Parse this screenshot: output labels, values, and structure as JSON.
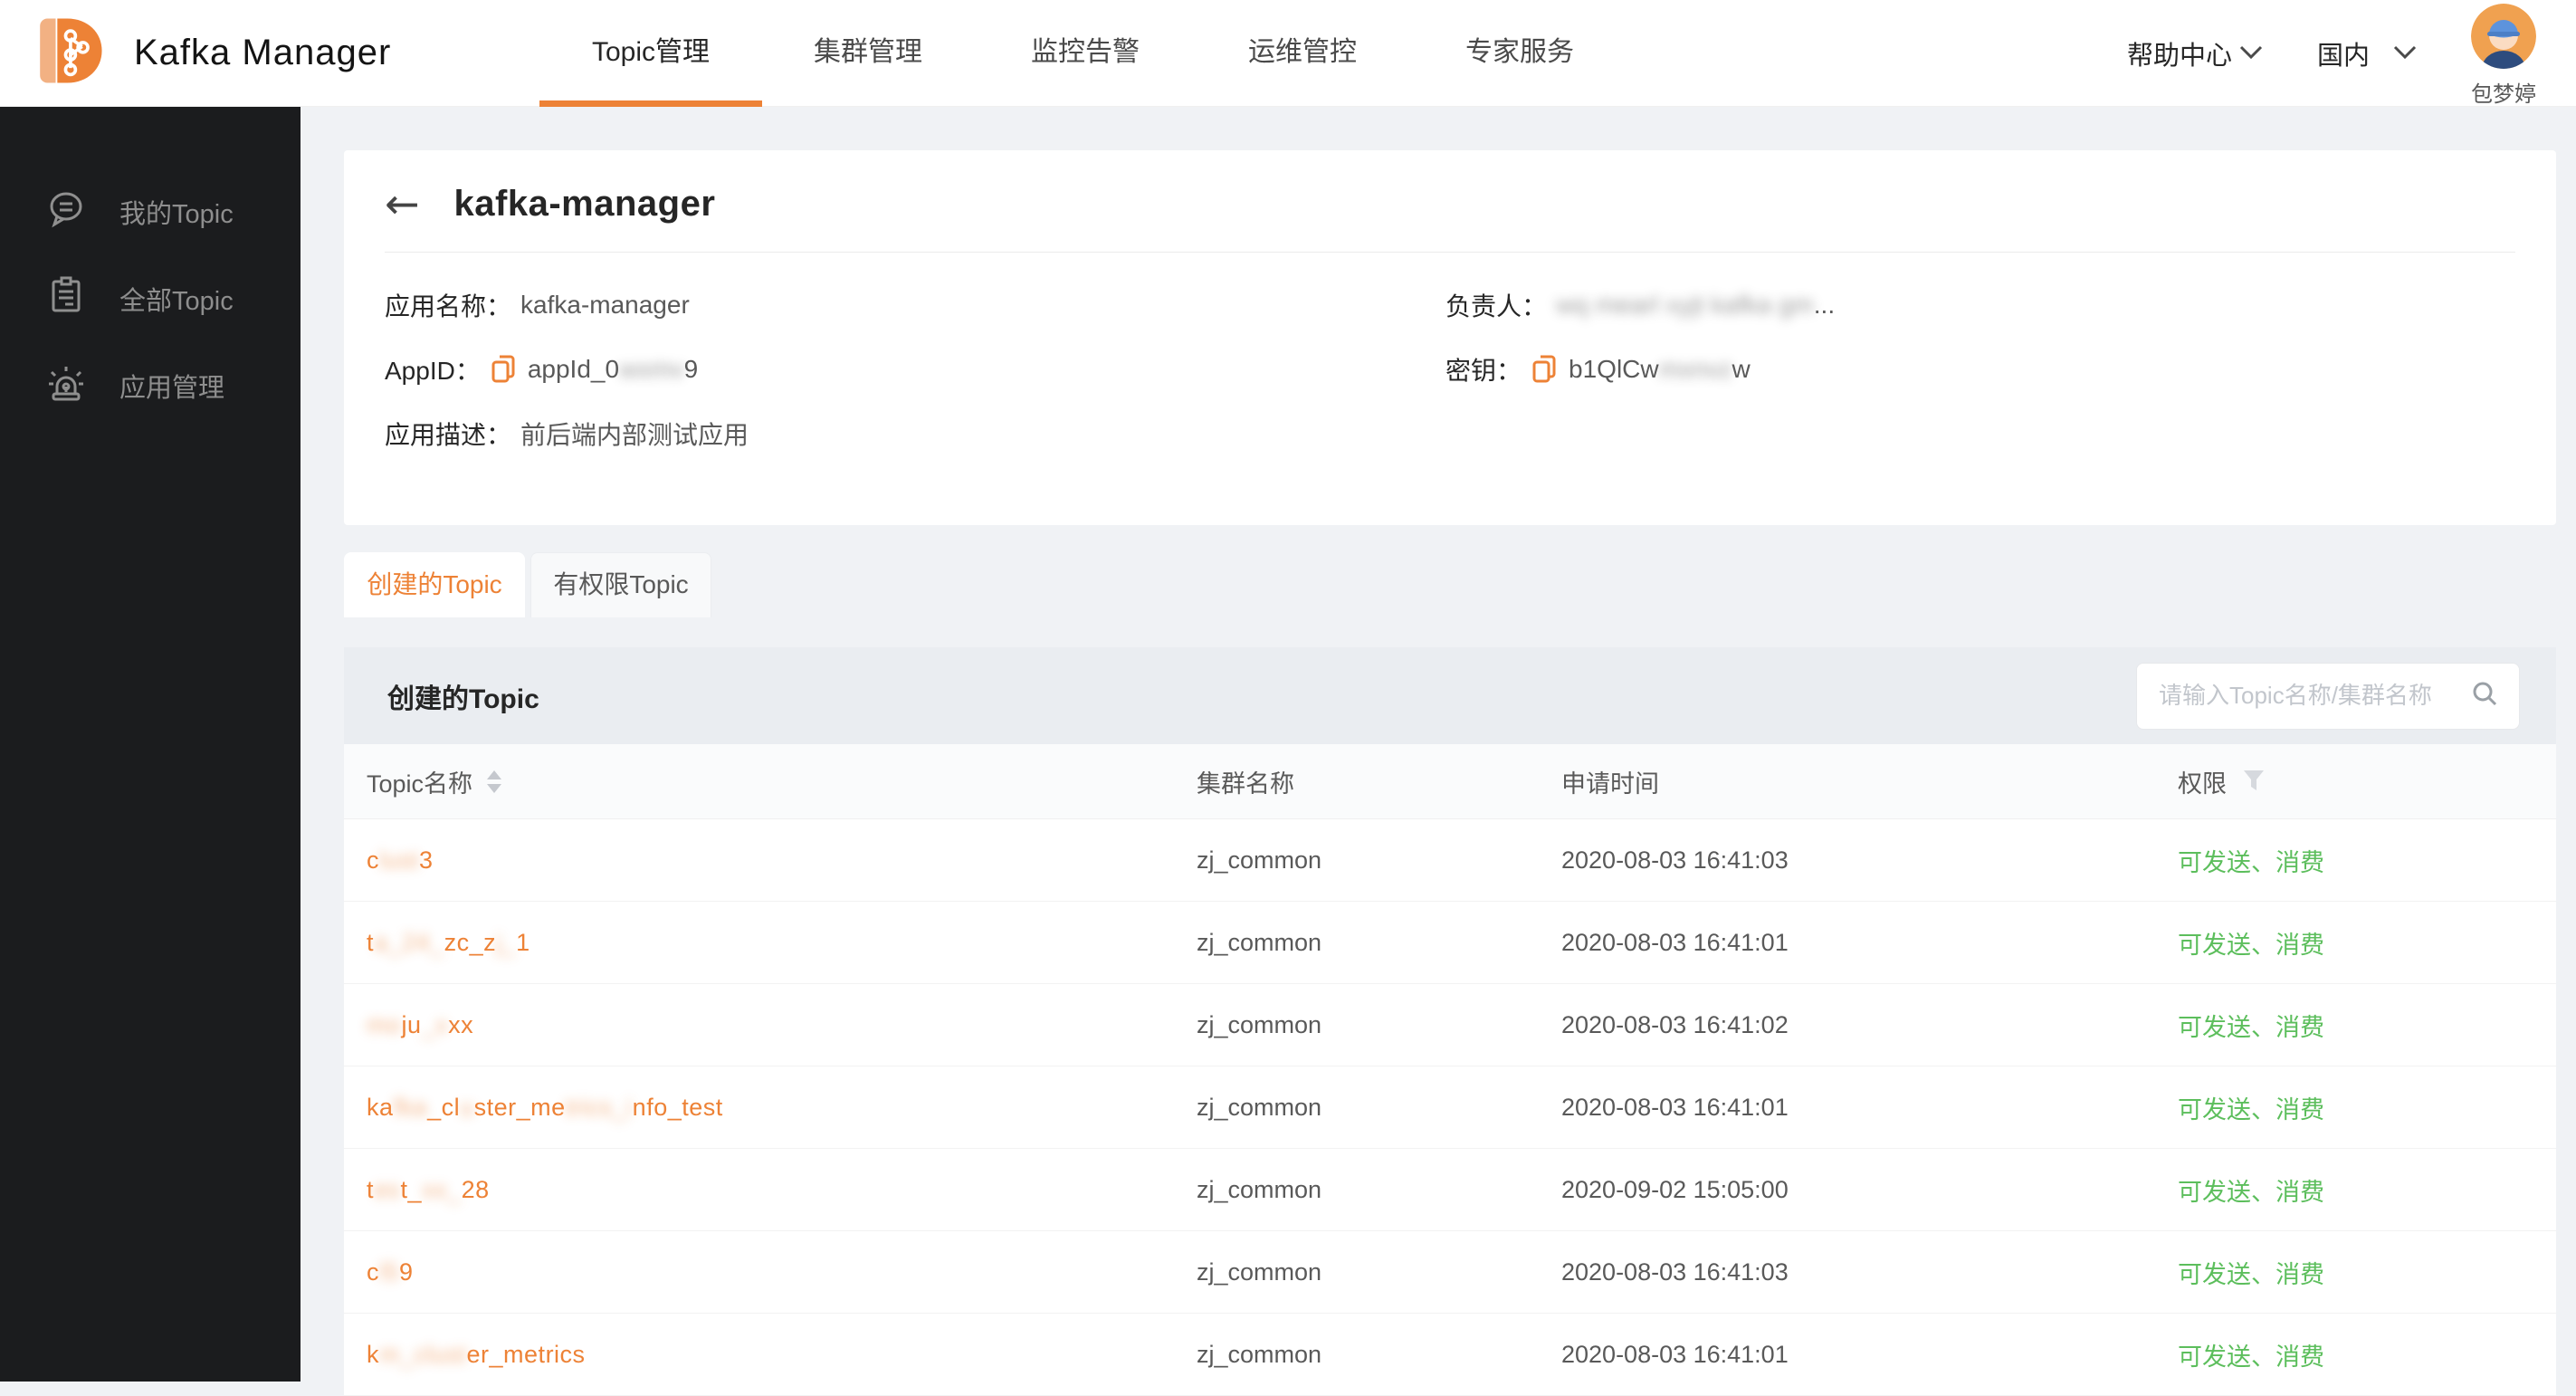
{
  "header": {
    "app_title": "Kafka Manager",
    "nav": [
      {
        "label": "Topic管理",
        "active": true
      },
      {
        "label": "集群管理",
        "active": false
      },
      {
        "label": "监控告警",
        "active": false
      },
      {
        "label": "运维管控",
        "active": false
      },
      {
        "label": "专家服务",
        "active": false
      }
    ],
    "help_label": "帮助中心",
    "region_label": "国内",
    "user_name": "包梦婷"
  },
  "sidebar": {
    "items": [
      {
        "label": "我的Topic",
        "icon": "chat-icon"
      },
      {
        "label": "全部Topic",
        "icon": "clipboard-icon"
      },
      {
        "label": "应用管理",
        "icon": "siren-icon"
      }
    ]
  },
  "app_card": {
    "back_glyph": "←",
    "title": "kafka-manager",
    "app_name_label": "应用名称：",
    "app_name": "kafka-manager",
    "app_id_label": "AppID：",
    "app_id_segments": [
      {
        "t": "appId_0"
      },
      {
        "t": "wxmv",
        "r": 1
      },
      {
        "t": "9"
      }
    ],
    "app_desc_label": "应用描述：",
    "app_desc": "前后端内部测试应用",
    "owner_label": "负责人：",
    "owner_segments": [
      {
        "t": "wq mearl xyjt kafka gm",
        "r": 1
      },
      {
        "t": "..."
      }
    ],
    "secret_label": "密钥：",
    "secret_segments": [
      {
        "t": "b1QlCw"
      },
      {
        "t": "mxnvz",
        "r": 1
      },
      {
        "t": "w"
      }
    ]
  },
  "tabs": [
    {
      "label": "创建的Topic",
      "active": true
    },
    {
      "label": "有权限Topic",
      "active": false
    }
  ],
  "table": {
    "section_title": "创建的Topic",
    "search_placeholder": "请输入Topic名称/集群名称",
    "columns": [
      "Topic名称",
      "集群名称",
      "申请时间",
      "权限"
    ],
    "rows": [
      {
        "topic_segments": [
          {
            "t": "c"
          },
          {
            "t": "lust",
            "r": 1
          },
          {
            "t": "3"
          }
        ],
        "cluster": "zj_common",
        "applied_at": "2020-08-03 16:41:03",
        "permission": "可发送、消费"
      },
      {
        "topic_segments": [
          {
            "t": "t"
          },
          {
            "t": "a_24_",
            "r": 1
          },
          {
            "t": "zc_z"
          },
          {
            "t": "j_",
            "r": 1
          },
          {
            "t": "1"
          }
        ],
        "cluster": "zj_common",
        "applied_at": "2020-08-03 16:41:01",
        "permission": "可发送、消费"
      },
      {
        "topic_segments": [
          {
            "t": "mo",
            "r": 1
          },
          {
            "t": "ju"
          },
          {
            "t": "_x",
            "r": 1
          },
          {
            "t": "xx"
          }
        ],
        "cluster": "zj_common",
        "applied_at": "2020-08-03 16:41:02",
        "permission": "可发送、消费"
      },
      {
        "topic_segments": [
          {
            "t": "ka"
          },
          {
            "t": "fka",
            "r": 1
          },
          {
            "t": "_cl"
          },
          {
            "t": "u",
            "r": 1
          },
          {
            "t": "ster_me"
          },
          {
            "t": "trics_i",
            "r": 1
          },
          {
            "t": "nfo_test"
          }
        ],
        "cluster": "zj_common",
        "applied_at": "2020-08-03 16:41:01",
        "permission": "可发送、消费"
      },
      {
        "topic_segments": [
          {
            "t": "t"
          },
          {
            "t": "es",
            "r": 1
          },
          {
            "t": "t_"
          },
          {
            "t": "xx_",
            "r": 1
          },
          {
            "t": "28"
          }
        ],
        "cluster": "zj_common",
        "applied_at": "2020-09-02 15:05:00",
        "permission": "可发送、消费"
      },
      {
        "topic_segments": [
          {
            "t": "c"
          },
          {
            "t": "l5",
            "r": 1
          },
          {
            "t": "9"
          }
        ],
        "cluster": "zj_common",
        "applied_at": "2020-08-03 16:41:03",
        "permission": "可发送、消费"
      },
      {
        "topic_segments": [
          {
            "t": "k"
          },
          {
            "t": "m_clust",
            "r": 1
          },
          {
            "t": "er_metrics"
          }
        ],
        "cluster": "zj_common",
        "applied_at": "2020-08-03 16:41:01",
        "permission": "可发送、消费"
      }
    ]
  },
  "colors": {
    "accent": "#ED8236",
    "permission_green": "#5CBE5C",
    "sidebar_bg": "#1B1C1E",
    "page_bg": "#F0F2F5"
  }
}
